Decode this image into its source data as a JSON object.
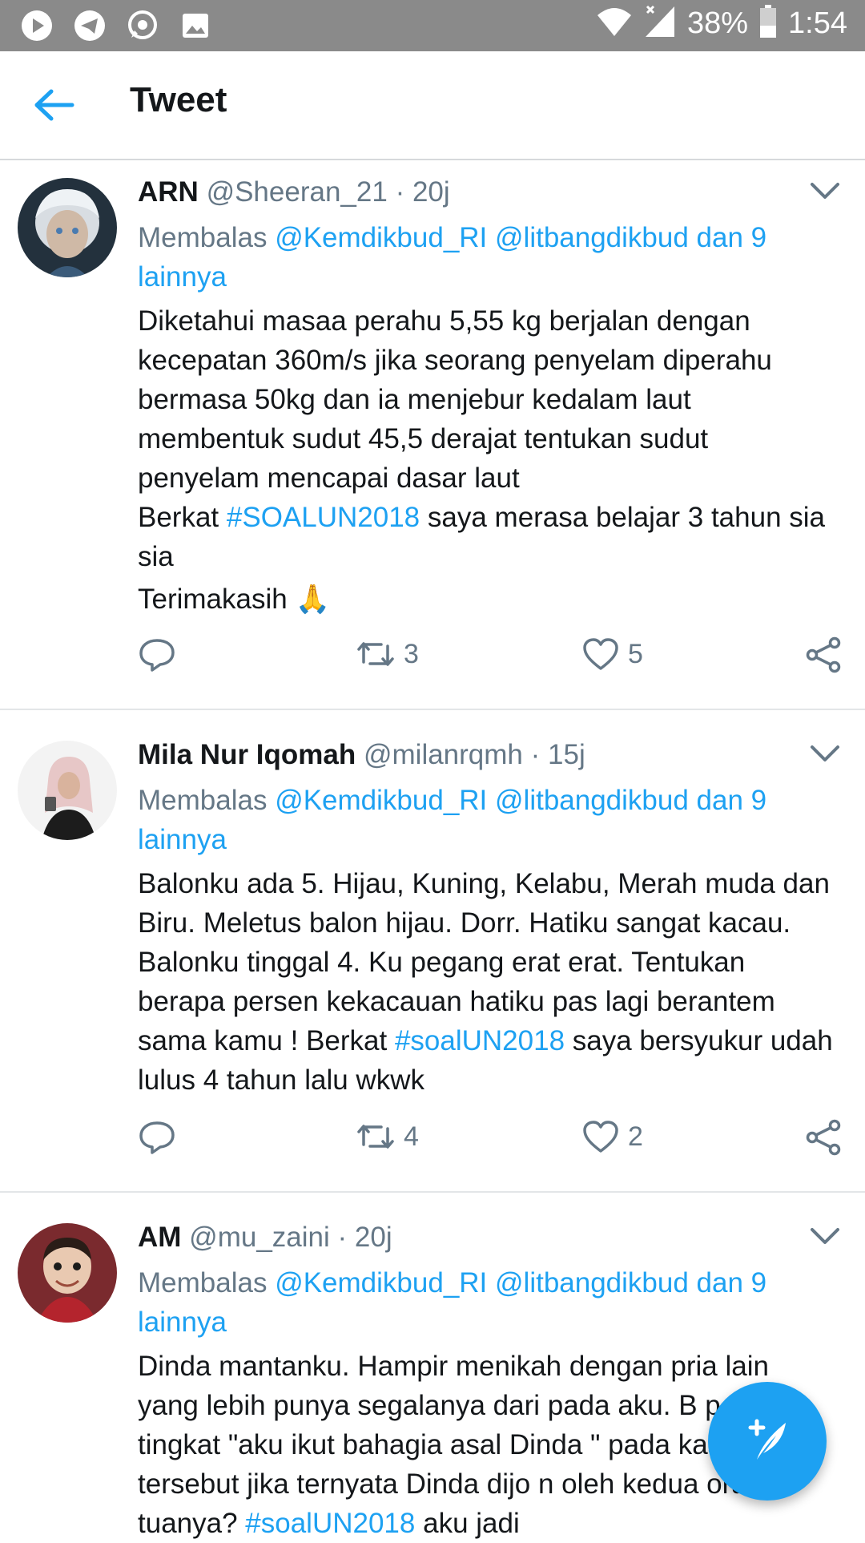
{
  "status_bar": {
    "battery": "38%",
    "time": "1:54",
    "icons": [
      "play-icon",
      "telegram-icon",
      "whatsapp-icon",
      "image-icon",
      "wifi-icon",
      "signal-icon",
      "battery-icon"
    ]
  },
  "header": {
    "title": "Tweet",
    "back_icon": "arrow-left-icon"
  },
  "tweets": [
    {
      "name": "ARN",
      "handle": "@Sheeran_21",
      "time": "20j",
      "reply_prefix": "Membalas",
      "reply_to": "@Kemdikbud_RI @litbangdikbud dan 9 lainnya",
      "text_1": "Diketahui masaa perahu 5,55 kg berjalan dengan kecepatan 360m/s jika seorang penyelam diperahu bermasa 50kg dan ia menjebur kedalam laut membentuk sudut 45,5 derajat tentukan sudut penyelam mencapai dasar laut",
      "text_2a": "Berkat ",
      "hashtag": "#SOALUN2018",
      "text_2b": " saya merasa belajar 3 tahun sia sia",
      "text_3": "Terimakasih ",
      "emoji": "🙏",
      "retweets": "3",
      "likes": "5"
    },
    {
      "name": "Mila Nur Iqomah",
      "handle": "@milanrqmh",
      "time": "15j",
      "reply_prefix": "Membalas",
      "reply_to": "@Kemdikbud_RI @litbangdikbud dan 9 lainnya",
      "text_1": "Balonku ada 5. Hijau, Kuning, Kelabu, Merah muda dan Biru. Meletus balon hijau. Dorr. Hatiku sangat kacau. Balonku tinggal 4. Ku pegang erat erat. Tentukan berapa persen kekacauan hatiku pas lagi berantem sama kamu ! Berkat ",
      "hashtag": "#soalUN2018",
      "text_2": " saya bersyukur udah lulus 4 tahun lalu wkwk",
      "retweets": "4",
      "likes": "2"
    },
    {
      "name": "AM",
      "handle": "@mu_zaini",
      "time": "20j",
      "reply_prefix": "Membalas",
      "reply_to": "@Kemdikbud_RI @litbangdikbud dan 9 lainnya",
      "text_1": "Dinda mantanku. Hampir menikah dengan pria lain yang lebih punya segalanya dari pada aku. B persen tingkat \"aku ikut bahagia asal Dinda \" pada kasus tersebut jika ternyata Dinda dijo n oleh kedua orang tuanya? ",
      "hashtag": "#soalUN2018",
      "text_2": " aku jadi"
    }
  ],
  "colors": {
    "accent": "#1da1f2",
    "muted": "#657786",
    "statusbar": "#8a8a8a"
  },
  "fab": {
    "icon": "compose-tweet-icon"
  }
}
